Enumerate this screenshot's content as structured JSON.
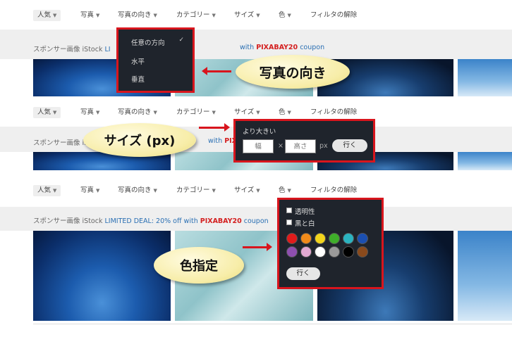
{
  "toolbar": {
    "popular": "人気",
    "photo": "写真",
    "orientation": "写真の向き",
    "category": "カテゴリー",
    "size": "サイズ",
    "color": "色",
    "clear": "フィルタの解除"
  },
  "sponsor": {
    "prefix": "スポンサー画像 iStock",
    "deal": "LIMITED DEAL: 20% off with",
    "code": "PIXABAY20",
    "suffix": "coupon",
    "partial_link": "LI",
    "partial_with": "with",
    "partial_code": "PIXABA"
  },
  "orientation_menu": {
    "items": [
      "任意の方向",
      "水平",
      "垂直"
    ],
    "selected_index": 0,
    "check": "✓"
  },
  "size_menu": {
    "title": "より大きい",
    "width_placeholder": "幅",
    "times": "×",
    "height_placeholder": "高さ",
    "unit": "px",
    "go": "行く"
  },
  "color_menu": {
    "transparent": "透明性",
    "bw": "黒と白",
    "go": "行く",
    "swatches": [
      "#e01b1b",
      "#f08a1a",
      "#f2d41c",
      "#3fae2a",
      "#2bb3c0",
      "#1b4fb0",
      "#8e4fb0",
      "#e2a9d2",
      "#ffffff",
      "#9a9a9a",
      "#000000",
      "#8a4a1c"
    ]
  },
  "callouts": {
    "orientation": "写真の向き",
    "size": "サイズ (px)",
    "color": "色指定"
  }
}
